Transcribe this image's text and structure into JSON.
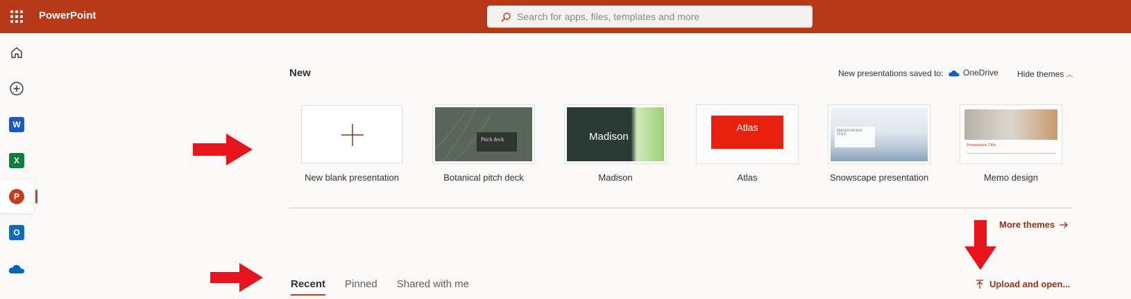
{
  "app": {
    "title": "PowerPoint"
  },
  "search": {
    "placeholder": "Search for apps, files, templates and more"
  },
  "rail": {
    "items": [
      {
        "name": "home",
        "icon": "home-icon"
      },
      {
        "name": "create",
        "icon": "add-circle-icon"
      },
      {
        "name": "word",
        "icon": "word-icon",
        "letter": "W",
        "color": "#185abd"
      },
      {
        "name": "excel",
        "icon": "excel-icon",
        "letter": "X",
        "color": "#107c41"
      },
      {
        "name": "powerpoint",
        "icon": "powerpoint-icon",
        "letter": "P",
        "color": "#c43e1c",
        "active": true
      },
      {
        "name": "outlook",
        "icon": "outlook-icon",
        "letter": "O",
        "color": "#0f6cbd"
      },
      {
        "name": "onedrive",
        "icon": "onedrive-icon",
        "color": "#0364b8"
      }
    ]
  },
  "new_section": {
    "title": "New",
    "saved_to": "New presentations saved to:",
    "saved_location": "OneDrive",
    "hide_themes": "Hide themes"
  },
  "templates": [
    {
      "label": "New blank presentation",
      "style": "blank"
    },
    {
      "label": "Botanical pitch deck",
      "style": "botanical",
      "thumb_text": "Pitch deck"
    },
    {
      "label": "Madison",
      "style": "madison",
      "thumb_text": "Madison"
    },
    {
      "label": "Atlas",
      "style": "atlas",
      "thumb_text": "Atlas"
    },
    {
      "label": "Snowscape presentation",
      "style": "snowscape",
      "thumb_text": "PRESENTATION TITLE"
    },
    {
      "label": "Memo design",
      "style": "memo",
      "thumb_text": "Presentation Title"
    }
  ],
  "more_themes": "More themes",
  "tabs": [
    {
      "label": "Recent",
      "active": true
    },
    {
      "label": "Pinned",
      "active": false
    },
    {
      "label": "Shared with me",
      "active": false
    }
  ],
  "upload": "Upload and open...",
  "colors": {
    "accent": "#b7391a",
    "annotation_arrow": "#e8141b"
  }
}
